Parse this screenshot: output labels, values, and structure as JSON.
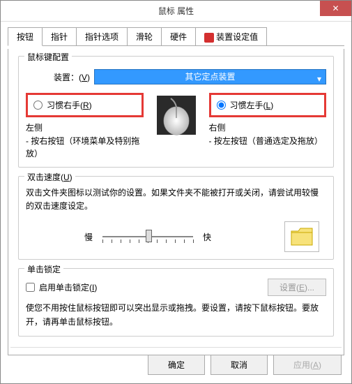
{
  "window": {
    "title": "鼠标 属性"
  },
  "tabs": {
    "items": [
      {
        "label": "按钮"
      },
      {
        "label": "指针"
      },
      {
        "label": "指针选项"
      },
      {
        "label": "滑轮"
      },
      {
        "label": "硬件"
      },
      {
        "label": "装置设定值"
      }
    ]
  },
  "config": {
    "group_title": "鼠标键配置",
    "device_label": "装置：(V)",
    "device_value": "其它定点装置",
    "right_hand": "习惯右手(R)",
    "left_hand": "习惯左手(L)",
    "left_title": "左侧",
    "left_desc": "- 按右按钮（环境菜单及特别拖放）",
    "right_title": "右侧",
    "right_desc": "- 按左按钮（普通选定及拖放）"
  },
  "dblclick": {
    "group_title": "双击速度(U)",
    "desc": "双击文件夹图标以测试你的设置。如果文件夹不能被打开或关闭，请尝试用较慢的双击速度设定。",
    "slow": "慢",
    "fast": "快"
  },
  "lock": {
    "group_title": "单击锁定",
    "check_label": "启用单击锁定(I)",
    "settings_btn": "设置(E)...",
    "desc": "使您不用按住鼠标按钮即可以突出显示或拖拽。要设置，请按下鼠标按钮。要放开，请再单击鼠标按钮。"
  },
  "footer": {
    "ok": "确定",
    "cancel": "取消",
    "apply": "应用(A)"
  }
}
